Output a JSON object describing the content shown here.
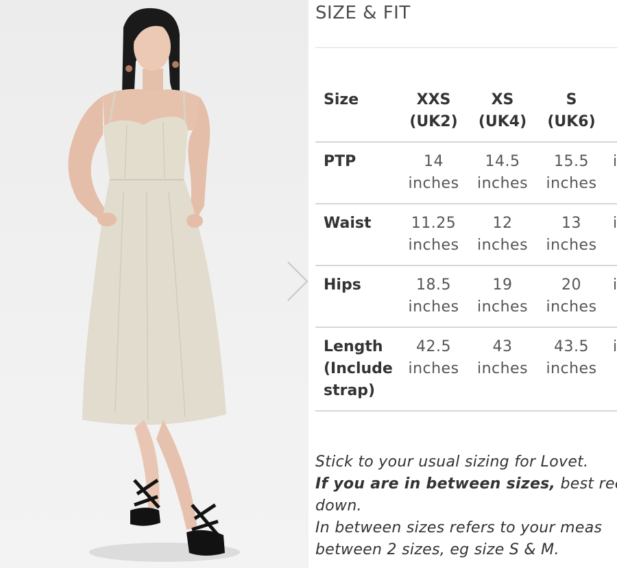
{
  "size_fit": {
    "title": "SIZE & FIT",
    "table": {
      "header_label": "Size",
      "sizes": [
        {
          "name": "XXS",
          "uk": "(UK2)"
        },
        {
          "name": "XS",
          "uk": "(UK4)"
        },
        {
          "name": "S",
          "uk": "(UK6)"
        },
        {
          "name": "",
          "uk": ""
        }
      ],
      "rows": [
        {
          "label": [
            "PTP"
          ],
          "values": [
            "14",
            "14.5",
            "15.5",
            ""
          ],
          "unit": "inches"
        },
        {
          "label": [
            "Waist"
          ],
          "values": [
            "11.25",
            "12",
            "13",
            ""
          ],
          "unit": "inches"
        },
        {
          "label": [
            "Hips"
          ],
          "values": [
            "18.5",
            "19",
            "20",
            ""
          ],
          "unit": "inches"
        },
        {
          "label": [
            "Length",
            "(Include",
            "strap)"
          ],
          "values": [
            "42.5",
            "43",
            "43.5",
            ""
          ],
          "unit": "inches"
        }
      ]
    },
    "notes": {
      "line1": "Stick to your usual sizing for Lovet.",
      "line2_bold": "If you are in between sizes,",
      "line2_rest": " best reco",
      "line3": "down.",
      "line4": "In between sizes refers to your meas",
      "line5": "between 2 sizes, eg size S & M."
    }
  },
  "gallery": {
    "next_icon": "chevron-right-icon",
    "colors": {
      "dress": "#e1dccd",
      "skin": "#e8c7b3",
      "hair": "#1a1a1a",
      "sandals": "#121212",
      "background": "#ededed"
    }
  }
}
